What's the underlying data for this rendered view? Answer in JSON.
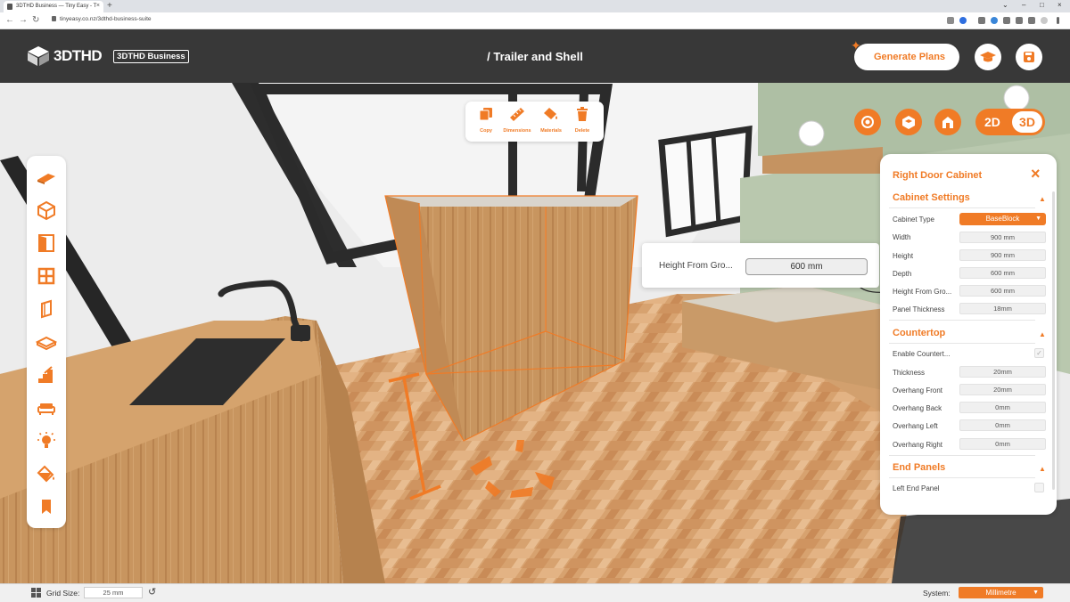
{
  "browser": {
    "tab_title": "3DTHD Business — Tiny Easy - T",
    "tab_close": "×",
    "new_tab": "+",
    "url": "tinyeasy.co.nz/3dthd-business-suite",
    "window_controls": [
      "⌄",
      "–",
      "□",
      "×"
    ]
  },
  "header": {
    "logo_text": "3DTHD",
    "edition_badge": "3DTHD Business",
    "project_title": "/ Trailer and Shell",
    "generate_button": "Generate Plans"
  },
  "action_bar": {
    "items": [
      {
        "label": "Copy",
        "icon": "copy-icon"
      },
      {
        "label": "Dimensions",
        "icon": "ruler-icon"
      },
      {
        "label": "Materials",
        "icon": "paint-bucket-icon"
      },
      {
        "label": "Delete",
        "icon": "trash-icon"
      }
    ]
  },
  "view_mode": {
    "option_2d": "2D",
    "option_3d": "3D",
    "active": "3D"
  },
  "height_popup": {
    "label": "Height From Gro...",
    "value": "600 mm"
  },
  "panel": {
    "title": "Right Door Cabinet",
    "close": "×",
    "sections": [
      {
        "title": "Cabinet Settings",
        "caret": "▲",
        "rows": [
          {
            "label": "Cabinet Type",
            "value": "BaseBlock",
            "kind": "select"
          },
          {
            "label": "Width",
            "value": "900 mm",
            "kind": "input"
          },
          {
            "label": "Height",
            "value": "900 mm",
            "kind": "input"
          },
          {
            "label": "Depth",
            "value": "600 mm",
            "kind": "input"
          },
          {
            "label": "Height From Gro...",
            "value": "600 mm",
            "kind": "input"
          },
          {
            "label": "Panel Thickness",
            "value": "18mm",
            "kind": "input"
          }
        ]
      },
      {
        "title": "Countertop",
        "caret": "▲",
        "rows": [
          {
            "label": "Enable Countert...",
            "value": "✓",
            "kind": "checkbox"
          },
          {
            "label": "Thickness",
            "value": "20mm",
            "kind": "input"
          },
          {
            "label": "Overhang Front",
            "value": "20mm",
            "kind": "input"
          },
          {
            "label": "Overhang Back",
            "value": "0mm",
            "kind": "input"
          },
          {
            "label": "Overhang Left",
            "value": "0mm",
            "kind": "input"
          },
          {
            "label": "Overhang Right",
            "value": "0mm",
            "kind": "input"
          }
        ]
      },
      {
        "title": "End Panels",
        "caret": "▲",
        "rows": [
          {
            "label": "Left End Panel",
            "value": "",
            "kind": "checkbox"
          }
        ]
      }
    ]
  },
  "left_toolbar": {
    "tools": [
      "floor-icon",
      "cube-icon",
      "door-icon",
      "window-icon",
      "wall-panel-icon",
      "box-icon",
      "stairs-icon",
      "sofa-icon",
      "light-icon",
      "paint-bucket-icon",
      "bookmark-icon"
    ]
  },
  "status_bar": {
    "grid_label": "Grid Size:",
    "grid_value": "25 mm",
    "reset": "↺",
    "system_label": "System:",
    "system_value": "Millimetre",
    "caret": "▼"
  },
  "colors": {
    "accent": "#f07b26",
    "header_bg": "#383838",
    "wood": "#c9915a",
    "floor": "#d9a673"
  }
}
